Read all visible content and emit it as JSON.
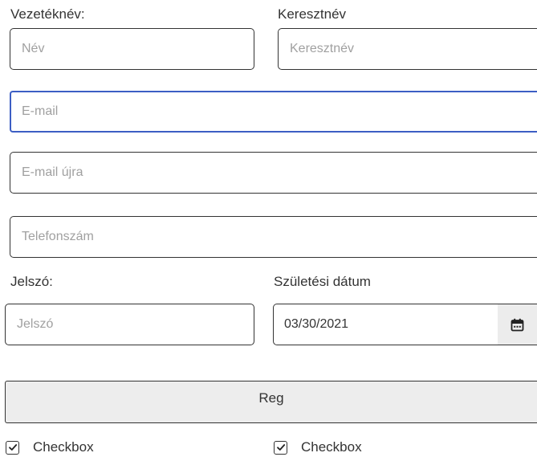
{
  "form": {
    "last_name": {
      "label": "Vezetéknév:",
      "placeholder": "Név",
      "value": ""
    },
    "first_name": {
      "label": "Keresztnév",
      "placeholder": "Keresztnév",
      "value": ""
    },
    "email": {
      "placeholder": "E-mail",
      "value": ""
    },
    "email_again": {
      "placeholder": "E-mail újra",
      "value": ""
    },
    "phone": {
      "placeholder": "Telefonszám",
      "value": ""
    },
    "password": {
      "label": "Jelszó:",
      "placeholder": "Jelszó",
      "value": ""
    },
    "birth_date": {
      "label": "Születési dátum",
      "value": "03/30/2021",
      "icon": "calendar-icon"
    },
    "submit_label": "Reg",
    "checkboxes": [
      {
        "label": "Checkbox",
        "checked": true
      },
      {
        "label": "Checkbox",
        "checked": true
      }
    ]
  },
  "colors": {
    "focus_border": "#3c5ec4",
    "placeholder": "#a0a0a0",
    "button_bg": "#ededed",
    "text": "#333333"
  }
}
